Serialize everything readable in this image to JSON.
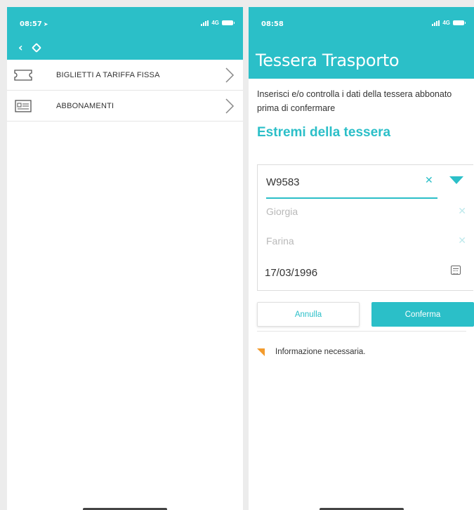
{
  "left_screen": {
    "status": {
      "time": "08:57",
      "network": "4G"
    },
    "menu_items": [
      {
        "label": "BIGLIETTI A TARIFFA FISSA",
        "icon": "ticket-icon"
      },
      {
        "label": "ABBONAMENTI",
        "icon": "pass-card-icon"
      }
    ]
  },
  "right_screen": {
    "status": {
      "time": "08:58",
      "network": "4G"
    },
    "title": "Tessera Trasporto",
    "intro": "Inserisci e/o controlla i dati della tessera abbonato prima di confermare",
    "section_title": "Estremi della tessera",
    "form": {
      "card_number": "W9583",
      "first_name_placeholder": "Giorgia",
      "last_name_placeholder": "Farina",
      "birth_date": "17/03/1996"
    },
    "buttons": {
      "cancel": "Annulla",
      "confirm": "Conferma"
    },
    "info_text": "Informazione necessaria.",
    "colors": {
      "accent": "#2bbfc8",
      "warning": "#f39b2d"
    }
  }
}
